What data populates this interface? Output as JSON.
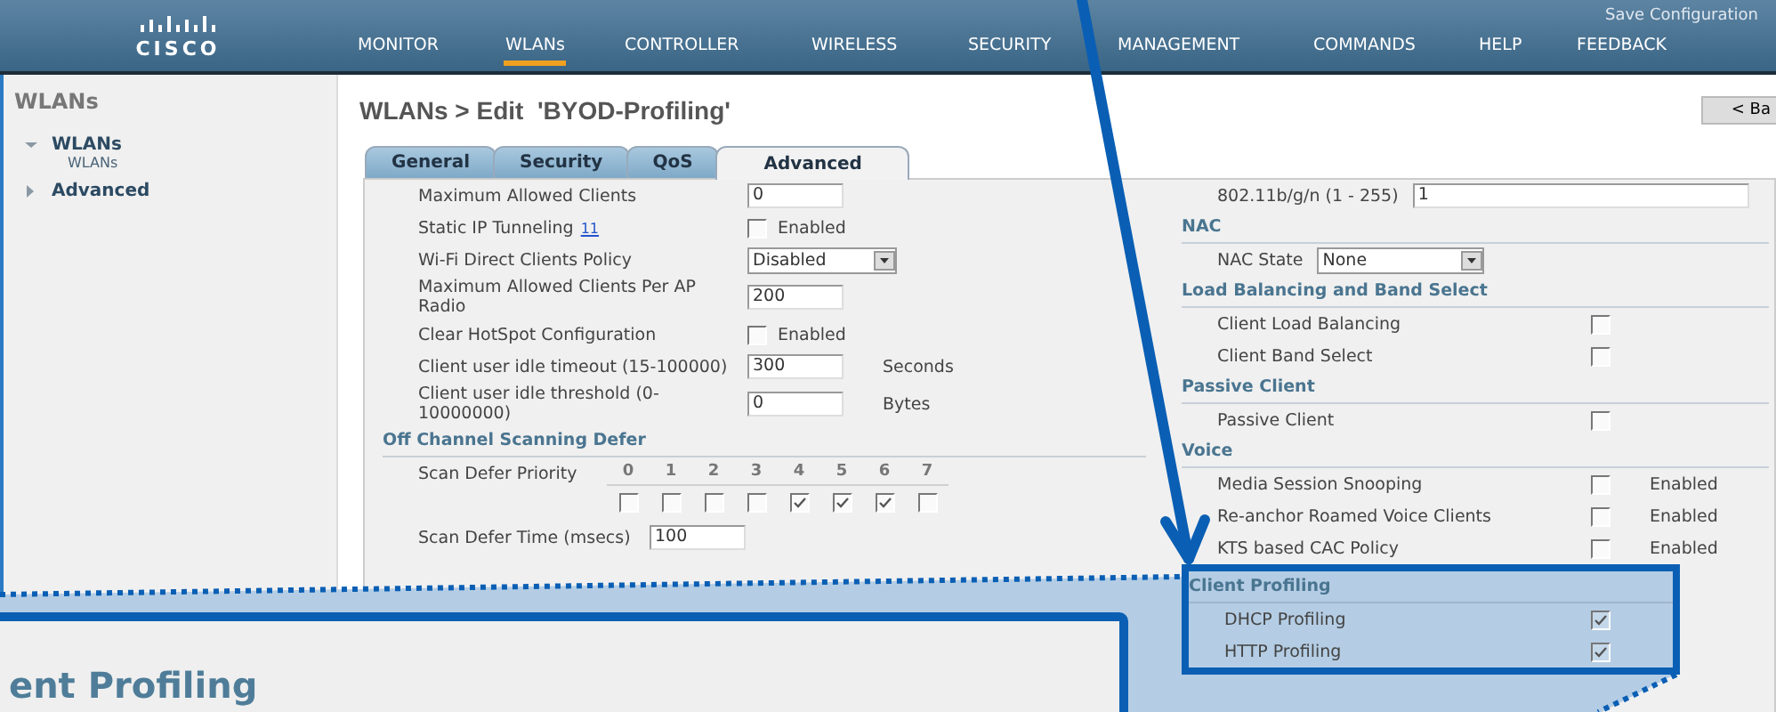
{
  "header": {
    "logo": "CISCO",
    "save_link": "Save Configuration",
    "nav": [
      {
        "label": "MONITOR",
        "selected": false
      },
      {
        "label": "WLANs",
        "selected": true
      },
      {
        "label": "CONTROLLER",
        "selected": false
      },
      {
        "label": "WIRELESS",
        "selected": false
      },
      {
        "label": "SECURITY",
        "selected": false
      },
      {
        "label": "MANAGEMENT",
        "selected": false
      },
      {
        "label": "COMMANDS",
        "selected": false
      },
      {
        "label": "HELP",
        "selected": false
      },
      {
        "label": "FEEDBACK",
        "selected": false
      }
    ]
  },
  "sidebar": {
    "title": "WLANs",
    "items": [
      {
        "label": "WLANs",
        "expanded": true,
        "children": [
          {
            "label": "WLANs"
          }
        ]
      },
      {
        "label": "Advanced",
        "expanded": false
      }
    ]
  },
  "page_title": "WLANs > Edit  'BYOD-Profiling'",
  "back_button": "< Ba",
  "tabs": [
    {
      "label": "General",
      "selected": false
    },
    {
      "label": "Security",
      "selected": false
    },
    {
      "label": "QoS",
      "selected": false
    },
    {
      "label": "Advanced",
      "selected": true
    }
  ],
  "left_sections": [
    {
      "rows": [
        {
          "kind": "input",
          "label": "Maximum Allowed Clients",
          "value": "0"
        },
        {
          "kind": "checkbox",
          "label": "Static IP Tunneling",
          "help": "11",
          "checked": false,
          "suffix": "Enabled"
        },
        {
          "kind": "select",
          "label": "Wi-Fi Direct Clients Policy",
          "value": "Disabled"
        },
        {
          "kind": "input",
          "label": "Maximum Allowed Clients Per AP Radio",
          "value": "200"
        },
        {
          "kind": "checkbox",
          "label": "Clear HotSpot Configuration",
          "checked": false,
          "suffix": "Enabled"
        },
        {
          "kind": "input",
          "label": "Client user idle timeout (15-100000)",
          "value": "300",
          "suffix": "Seconds"
        },
        {
          "kind": "input",
          "label": "Client user idle threshold (0-10000000)",
          "value": "0",
          "suffix": "Bytes"
        }
      ]
    },
    {
      "title": "Off Channel Scanning Defer",
      "rows": [
        {
          "kind": "priority",
          "label": "Scan Defer Priority",
          "priorities": [
            {
              "label": "0",
              "checked": false
            },
            {
              "label": "1",
              "checked": false
            },
            {
              "label": "2",
              "checked": false
            },
            {
              "label": "3",
              "checked": false
            },
            {
              "label": "4",
              "checked": true
            },
            {
              "label": "5",
              "checked": true
            },
            {
              "label": "6",
              "checked": true
            },
            {
              "label": "7",
              "checked": false
            }
          ]
        },
        {
          "kind": "input",
          "label": "Scan Defer Time (msecs)",
          "value": "100"
        }
      ]
    }
  ],
  "right_sections": [
    {
      "highlighted": false,
      "rows": [
        {
          "kind": "input",
          "label": "802.11b/g/n (1 - 255)",
          "value": "1"
        }
      ]
    },
    {
      "title": "NAC",
      "highlighted": false,
      "rows": [
        {
          "kind": "select",
          "label": "NAC State",
          "value": "None"
        }
      ]
    },
    {
      "title": "Load Balancing and Band Select",
      "highlighted": false,
      "rows": [
        {
          "kind": "checkbox",
          "label": "Client Load Balancing",
          "checked": false
        },
        {
          "kind": "checkbox",
          "label": "Client Band Select",
          "checked": false
        }
      ]
    },
    {
      "title": "Passive Client",
      "highlighted": false,
      "rows": [
        {
          "kind": "checkbox",
          "label": "Passive Client",
          "checked": false
        }
      ]
    },
    {
      "title": "Voice",
      "highlighted": false,
      "rows": [
        {
          "kind": "checkbox",
          "label": "Media Session Snooping",
          "checked": false,
          "suffix": "Enabled"
        },
        {
          "kind": "checkbox",
          "label": "Re-anchor Roamed Voice Clients",
          "checked": false,
          "suffix": "Enabled"
        },
        {
          "kind": "checkbox",
          "label": "KTS based CAC Policy",
          "checked": false,
          "suffix": "Enabled"
        }
      ]
    },
    {
      "title": "Client Profiling",
      "highlighted": true,
      "rows": [
        {
          "kind": "checkbox",
          "label": "DHCP Profiling",
          "checked": true
        },
        {
          "kind": "checkbox",
          "label": "HTTP Profiling",
          "checked": true
        }
      ]
    }
  ],
  "callout": {
    "text": "ent Profiling"
  }
}
